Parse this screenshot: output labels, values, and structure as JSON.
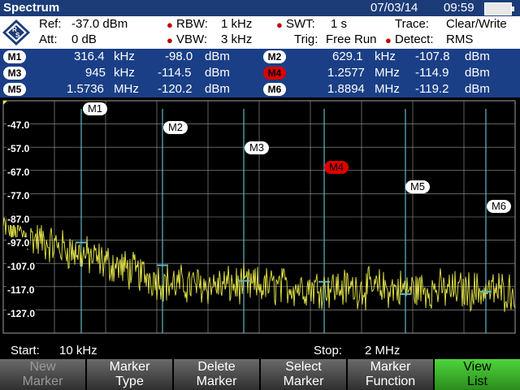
{
  "titlebar": {
    "app": "Spectrum",
    "date": "07/03/14",
    "time": "09:59"
  },
  "settings": {
    "ref_label": "Ref:",
    "ref_value": "-37.0 dBm",
    "att_label": "Att:",
    "att_value": "0 dB",
    "rbw_label": "RBW:",
    "rbw_value": "1 kHz",
    "vbw_label": "VBW:",
    "vbw_value": "3 kHz",
    "swt_label": "SWT:",
    "swt_value": "1 s",
    "trig_label": "Trig:",
    "trig_value": "Free Run",
    "trace_label": "Trace:",
    "trace_value": "Clear/Write",
    "detect_label": "Detect:",
    "detect_value": "RMS"
  },
  "markers_table": [
    {
      "id": "M1",
      "freq": "316.4",
      "freq_unit": "kHz",
      "level": "-98.0",
      "level_unit": "dBm"
    },
    {
      "id": "M2",
      "freq": "629.1",
      "freq_unit": "kHz",
      "level": "-107.8",
      "level_unit": "dBm"
    },
    {
      "id": "M3",
      "freq": "945",
      "freq_unit": "kHz",
      "level": "-114.5",
      "level_unit": "dBm"
    },
    {
      "id": "M4",
      "freq": "1.2577",
      "freq_unit": "MHz",
      "level": "-114.9",
      "level_unit": "dBm"
    },
    {
      "id": "M5",
      "freq": "1.5736",
      "freq_unit": "MHz",
      "level": "-120.2",
      "level_unit": "dBm"
    },
    {
      "id": "M6",
      "freq": "1.8894",
      "freq_unit": "MHz",
      "level": "-119.2",
      "level_unit": "dBm"
    }
  ],
  "plot": {
    "y_ticks": [
      "-47.0",
      "-57.0",
      "-67.0",
      "-77.0",
      "-87.0",
      "-97.0",
      "-107.0",
      "-117.0",
      "-127.0"
    ],
    "marker_labels": [
      "M1",
      "M2",
      "M3",
      "M4",
      "M5",
      "M6"
    ],
    "active_marker": "M4",
    "trace_color": "#e8e84a",
    "grid_color": "#a0a0a0",
    "marker_line_color": "#5fb8c8"
  },
  "sweep": {
    "start_label": "Start:",
    "start_value": "10 kHz",
    "stop_label": "Stop:",
    "stop_value": "2 MHz"
  },
  "softkeys": [
    {
      "line1": "New",
      "line2": "Marker",
      "state": "disabled"
    },
    {
      "line1": "Marker",
      "line2": "Type",
      "state": "normal"
    },
    {
      "line1": "Delete",
      "line2": "Marker",
      "state": "normal"
    },
    {
      "line1": "Select",
      "line2": "Marker",
      "state": "normal"
    },
    {
      "line1": "Marker",
      "line2": "Function",
      "state": "normal"
    },
    {
      "line1": "View",
      "line2": "List",
      "state": "active"
    }
  ]
}
